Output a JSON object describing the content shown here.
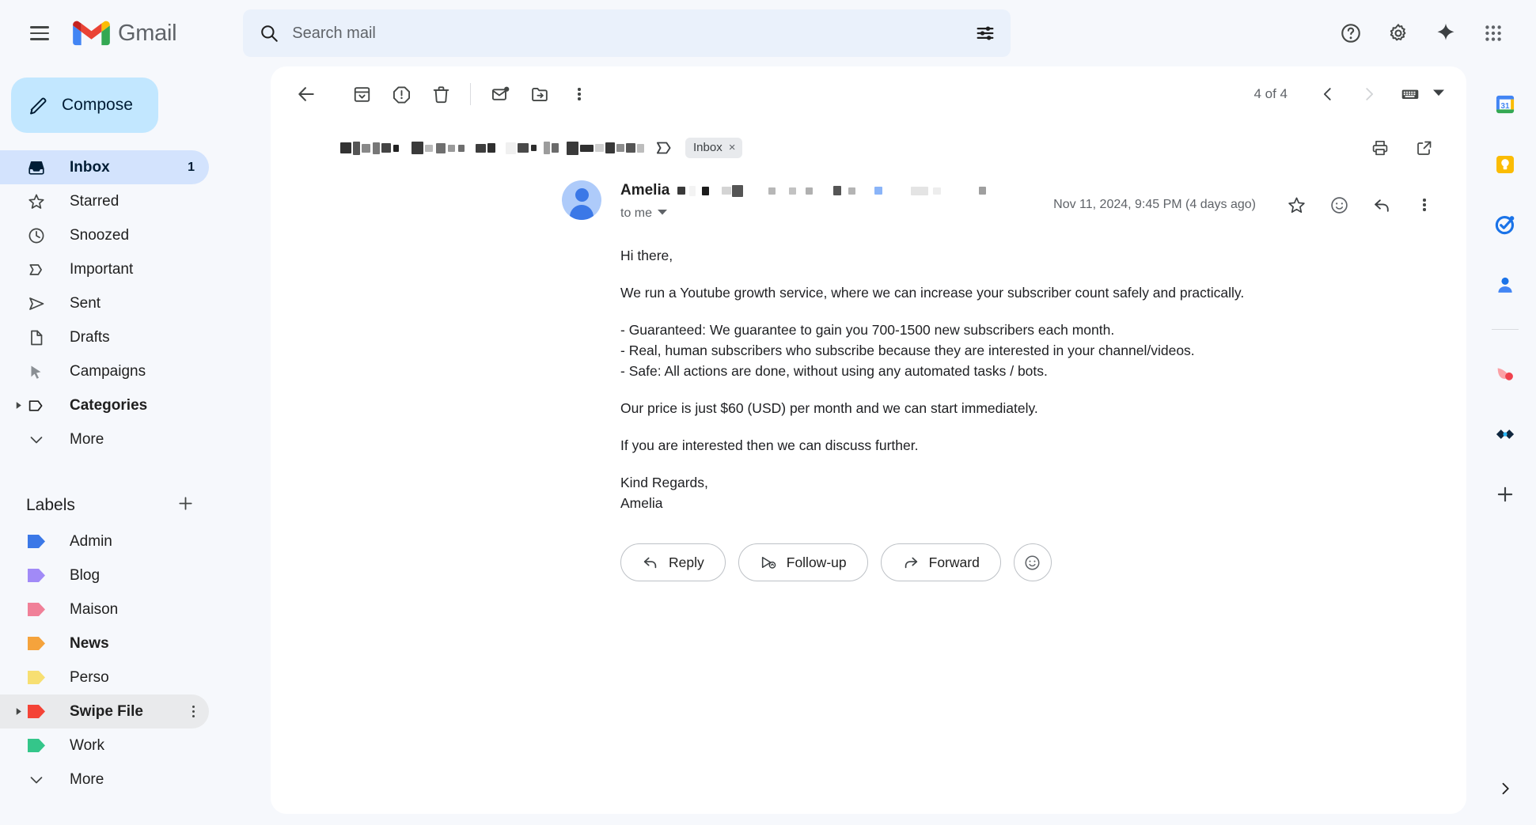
{
  "app": {
    "brand_name": "Gmail",
    "logo_icon": "gmail-logo-icon",
    "menu_icon": "hamburger-menu-icon"
  },
  "search": {
    "placeholder": "Search mail",
    "value": "",
    "search_icon": "search-icon",
    "filter_icon": "filter-options-icon"
  },
  "header_actions": [
    {
      "name": "support-icon",
      "title": "Support"
    },
    {
      "name": "settings-gear-icon",
      "title": "Settings"
    },
    {
      "name": "gemini-sparkle-icon",
      "title": "Gemini"
    },
    {
      "name": "apps-grid-icon",
      "title": "Google apps"
    }
  ],
  "sidebar": {
    "compose_label": "Compose",
    "compose_icon": "pencil-icon",
    "nav_items": [
      {
        "label": "Inbox",
        "icon": "inbox-icon",
        "count": "1",
        "active": true,
        "bold": true
      },
      {
        "label": "Starred",
        "icon": "star-icon",
        "count": "",
        "active": false,
        "bold": false
      },
      {
        "label": "Snoozed",
        "icon": "clock-icon",
        "count": "",
        "active": false,
        "bold": false
      },
      {
        "label": "Important",
        "icon": "important-chevron-icon",
        "count": "",
        "active": false,
        "bold": false
      },
      {
        "label": "Sent",
        "icon": "send-icon",
        "count": "",
        "active": false,
        "bold": false
      },
      {
        "label": "Drafts",
        "icon": "draft-page-icon",
        "count": "",
        "active": false,
        "bold": false
      },
      {
        "label": "Campaigns",
        "icon": "campaigns-cursor-icon",
        "count": "",
        "active": false,
        "bold": false
      },
      {
        "label": "Categories",
        "icon": "label-tag-icon",
        "count": "",
        "active": false,
        "bold": true,
        "expandable": true
      },
      {
        "label": "More",
        "icon": "chevron-down-icon",
        "count": "",
        "active": false,
        "bold": false
      }
    ],
    "labels_title": "Labels",
    "add_label_icon": "plus-icon",
    "labels": [
      {
        "label": "Admin",
        "color": "#3b78e7",
        "bold": false
      },
      {
        "label": "Blog",
        "color": "#a18af7",
        "bold": false
      },
      {
        "label": "Maison",
        "color": "#f08098",
        "bold": false
      },
      {
        "label": "News",
        "color": "#f5a33c",
        "bold": true
      },
      {
        "label": "Perso",
        "color": "#f7df72",
        "bold": false
      },
      {
        "label": "Swipe File",
        "color": "#f44336",
        "bold": true,
        "selected": true,
        "expandable": true,
        "menu_icon": "more-vertical-icon"
      },
      {
        "label": "Work",
        "color": "#34c68a",
        "bold": false
      },
      {
        "label": "More",
        "color": "",
        "icon": "chevron-down-icon",
        "bold": false
      }
    ]
  },
  "mail_toolbar": {
    "back_icon": "back-arrow-icon",
    "archive_icon": "archive-icon",
    "spam_icon": "report-spam-icon",
    "delete_icon": "trash-icon",
    "unread_icon": "mark-unread-icon",
    "move_icon": "move-to-folder-icon",
    "more_icon": "more-vertical-icon",
    "pager_text": "4 of 4",
    "prev_icon": "chevron-left-icon",
    "next_icon": "chevron-right-icon",
    "keyboard_icon": "keyboard-input-tools-icon",
    "keyboard_caret_icon": "caret-down-icon"
  },
  "email": {
    "subject_redacted": true,
    "important_icon": "important-chevron-icon",
    "inbox_chip_label": "Inbox",
    "inbox_chip_remove": "×",
    "print_icon": "print-icon",
    "popout_icon": "open-in-new-window-icon",
    "sender_name": "Amelia",
    "avatar_name": "sender-avatar",
    "to_line": "to me",
    "to_caret_icon": "caret-down-icon",
    "date": "Nov 11, 2024, 9:45 PM (4 days ago)",
    "star_icon": "star-icon",
    "react_icon": "emoji-react-icon",
    "reply_icon": "reply-arrow-icon",
    "more_icon": "more-vertical-icon",
    "body": {
      "greeting": "Hi there,",
      "intro": "We run a Youtube growth service, where we can increase your subscriber count safely and practically.",
      "bullets": [
        "- Guaranteed: We guarantee to gain you 700-1500 new subscribers each month.",
        "- Real, human subscribers who subscribe because they are interested in your channel/videos.",
        "- Safe: All actions are done, without using any automated tasks / bots."
      ],
      "price": "Our price is just $60 (USD) per month and we can start immediately.",
      "cta": "If you are interested then we can discuss further.",
      "signoff": "Kind Regards,",
      "signature": "Amelia"
    },
    "actions": [
      {
        "label": "Reply",
        "icon": "reply-arrow-icon"
      },
      {
        "label": "Follow-up",
        "icon": "follow-up-icon"
      },
      {
        "label": "Forward",
        "icon": "forward-arrow-icon"
      }
    ],
    "emoji_action_icon": "emoji-react-icon"
  },
  "right_rail": {
    "items": [
      {
        "name": "google-calendar-icon",
        "badge": "31"
      },
      {
        "name": "google-keep-icon",
        "badge": ""
      },
      {
        "name": "google-tasks-icon",
        "badge": ""
      },
      {
        "name": "google-contacts-icon",
        "badge": ""
      }
    ],
    "addons": [
      {
        "name": "addon-red-icon"
      },
      {
        "name": "addon-dark-blue-icon"
      }
    ],
    "add_icon": "plus-icon",
    "expand_icon": "chevron-right-icon"
  }
}
